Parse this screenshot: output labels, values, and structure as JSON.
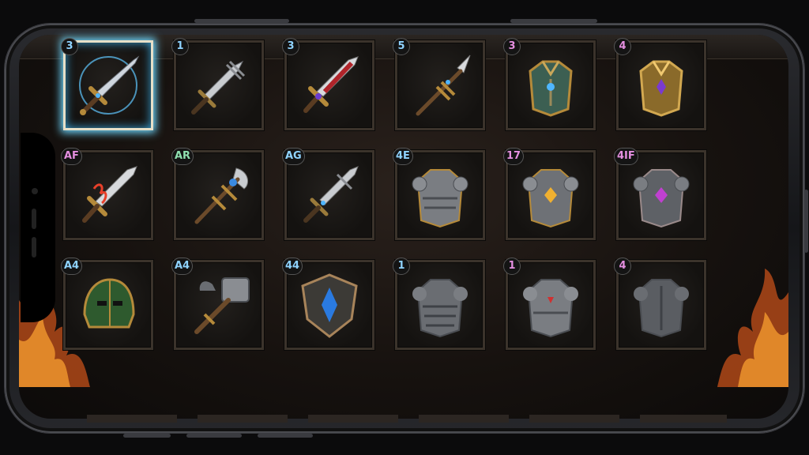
{
  "inventory": {
    "slots": [
      {
        "badge": "3",
        "badge_color": "#8fd3ff",
        "icon": "glowing-sword-icon",
        "selected": true
      },
      {
        "badge": "1",
        "badge_color": "#8fd3ff",
        "icon": "dagger-icon"
      },
      {
        "badge": "3",
        "badge_color": "#8fd3ff",
        "icon": "red-sword-icon"
      },
      {
        "badge": "5",
        "badge_color": "#8fd3ff",
        "icon": "spear-icon"
      },
      {
        "badge": "3",
        "badge_color": "#e48fe0",
        "icon": "green-chestplate-icon"
      },
      {
        "badge": "4",
        "badge_color": "#e48fe0",
        "icon": "gold-chestplate-icon"
      },
      {
        "badge": "AF",
        "badge_color": "#e48fe0",
        "icon": "flame-sword-icon"
      },
      {
        "badge": "AR",
        "badge_color": "#8fe0b0",
        "icon": "blue-gem-axe-icon"
      },
      {
        "badge": "AG",
        "badge_color": "#8fd3ff",
        "icon": "blue-sword-icon"
      },
      {
        "badge": "4E",
        "badge_color": "#8fd3ff",
        "icon": "steel-armor-icon"
      },
      {
        "badge": "17",
        "badge_color": "#e48fe0",
        "icon": "gold-gem-armor-icon"
      },
      {
        "badge": "4IF",
        "badge_color": "#e48fe0",
        "icon": "purple-gem-armor-icon"
      },
      {
        "badge": "A4",
        "badge_color": "#8fd3ff",
        "icon": "green-helmet-icon"
      },
      {
        "badge": "A4",
        "badge_color": "#8fd3ff",
        "icon": "war-hammer-icon"
      },
      {
        "badge": "44",
        "badge_color": "#8fd3ff",
        "icon": "blue-shield-icon"
      },
      {
        "badge": "1",
        "badge_color": "#8fd3ff",
        "icon": "iron-armor-icon"
      },
      {
        "badge": "1",
        "badge_color": "#e48fe0",
        "icon": "red-gem-armor-icon"
      },
      {
        "badge": "4",
        "badge_color": "#e48fe0",
        "icon": "plain-armor-icon"
      }
    ]
  }
}
